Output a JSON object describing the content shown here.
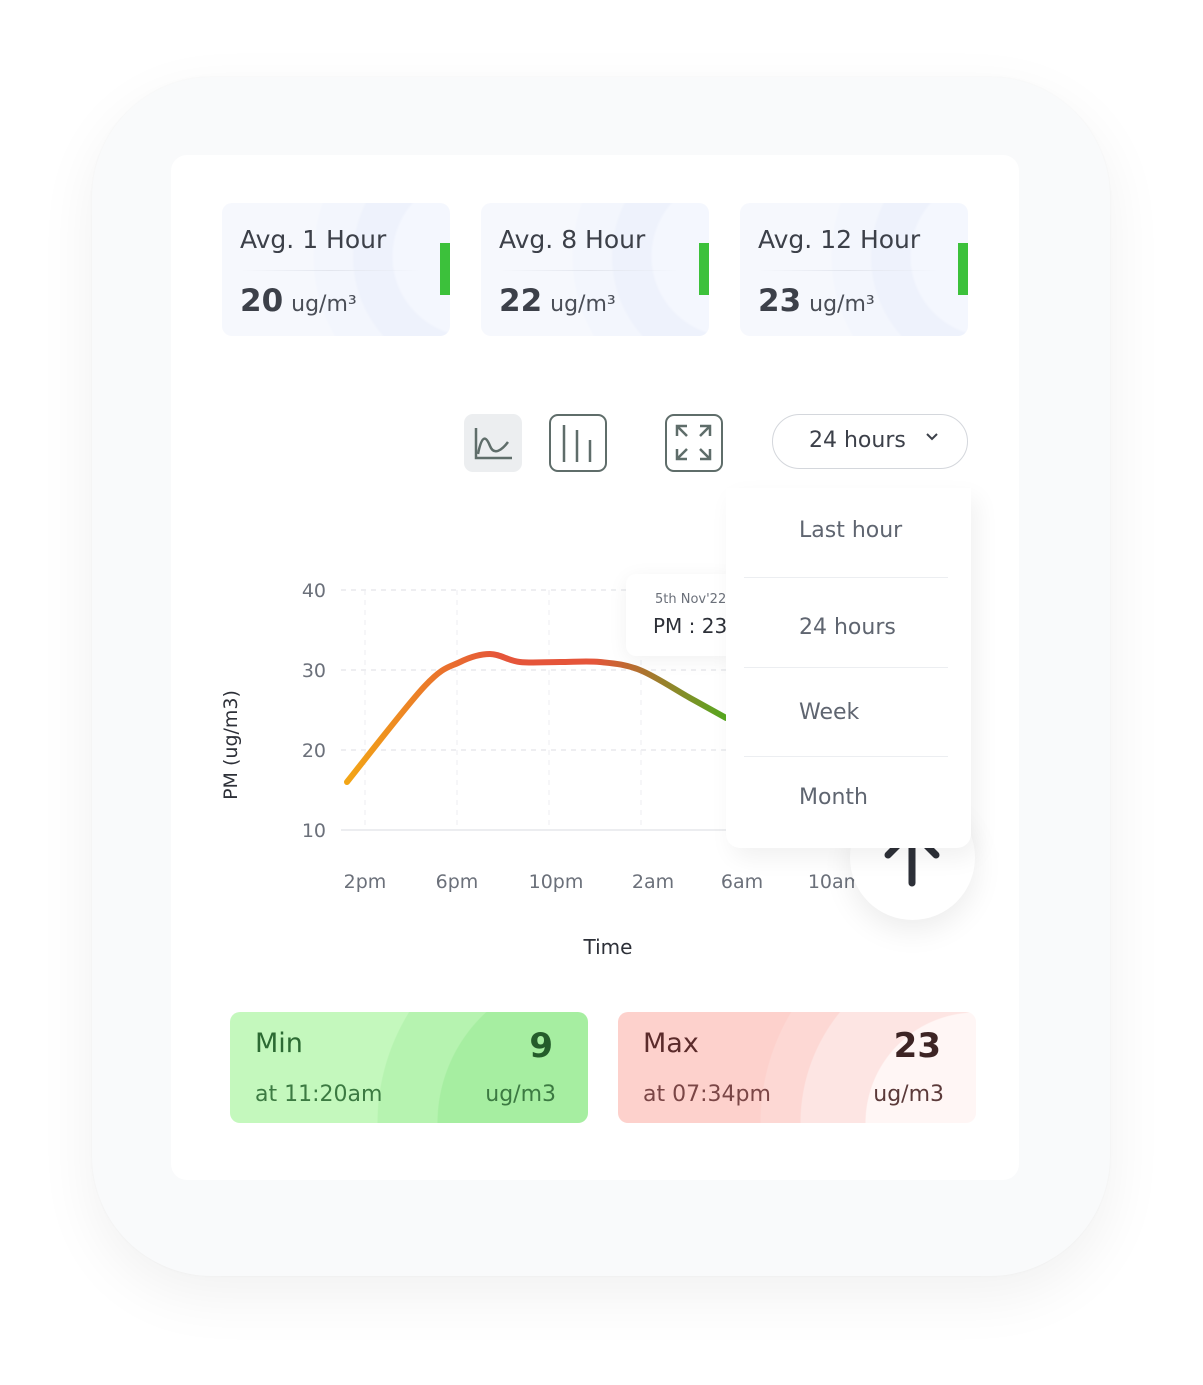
{
  "averages": [
    {
      "label": "Avg. 1 Hour",
      "value": "20",
      "unit": "ug/m³",
      "status_color": "#3cc13b"
    },
    {
      "label": "Avg. 8 Hour",
      "value": "22",
      "unit": "ug/m³",
      "status_color": "#3cc13b"
    },
    {
      "label": "Avg. 12 Hour",
      "value": "23",
      "unit": "ug/m³",
      "status_color": "#3cc13b"
    }
  ],
  "toolbar": {
    "icons": [
      "line-chart-icon",
      "bar-chart-icon",
      "expand-icon"
    ],
    "active": "line-chart-icon",
    "range_selected": "24 hours"
  },
  "range_menu": {
    "options": [
      "Last hour",
      "24 hours",
      "Week",
      "Month"
    ]
  },
  "tooltip": {
    "date": "5th Nov'22",
    "value": "PM : 23"
  },
  "chart_data": {
    "type": "line",
    "xlabel": "Time",
    "ylabel": "PM (ug/m3)",
    "y_ticks": [
      40,
      30,
      20,
      10
    ],
    "ylim": [
      10,
      40
    ],
    "x_ticks": [
      "2pm",
      "6pm",
      "10pm",
      "2am",
      "6am",
      "10am"
    ],
    "grid": true,
    "colors": [
      "#f2a516",
      "#e5553a",
      "#55a81f"
    ],
    "points": [
      {
        "x": "1:13pm",
        "y": 16
      },
      {
        "x": "4:36pm",
        "y": 28
      },
      {
        "x": "6:08pm",
        "y": 31
      },
      {
        "x": "7:26pm",
        "y": 32
      },
      {
        "x": "8:44pm",
        "y": 31
      },
      {
        "x": "10:28pm",
        "y": 31
      },
      {
        "x": "12:13am",
        "y": 31
      },
      {
        "x": "1:57am",
        "y": 30
      },
      {
        "x": "4:08am",
        "y": 26.5
      },
      {
        "x": "5:42am",
        "y": 24
      }
    ]
  },
  "min": {
    "label": "Min",
    "time": "at 11:20am",
    "value": "9",
    "unit": "ug/m3"
  },
  "max": {
    "label": "Max",
    "time": "at 07:34pm",
    "value": "23",
    "unit": "ug/m3"
  }
}
